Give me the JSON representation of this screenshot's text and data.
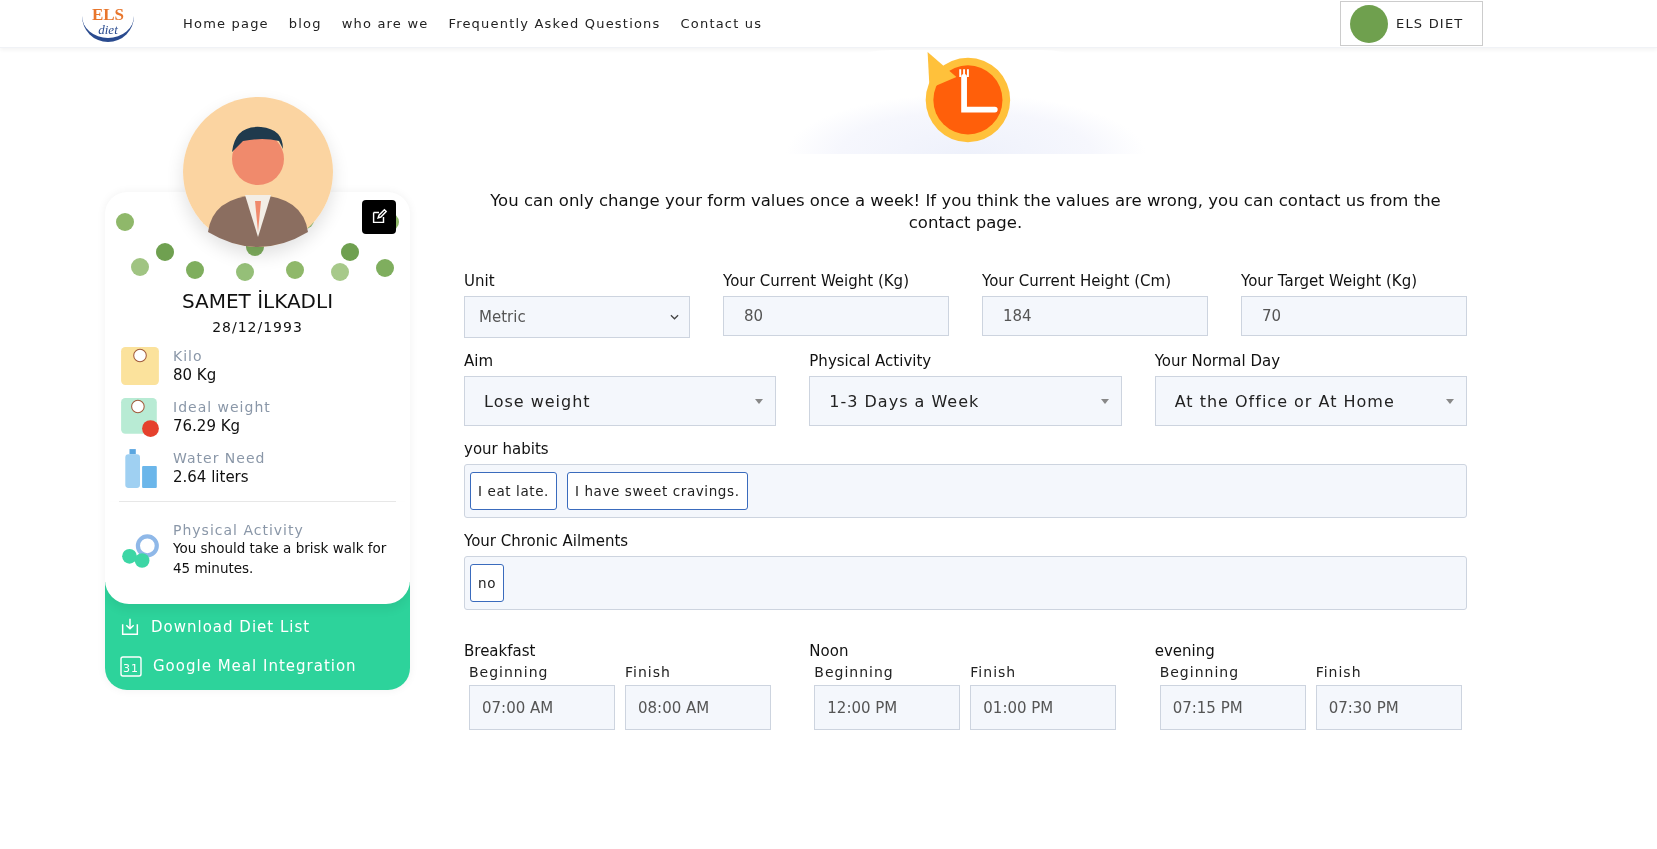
{
  "nav": {
    "logo": {
      "top": "ELS",
      "bottom": "diet"
    },
    "links": [
      {
        "label": "Home page"
      },
      {
        "label": "blog"
      },
      {
        "label": "who are we"
      },
      {
        "label": "Frequently Asked Questions"
      },
      {
        "label": "Contact us"
      }
    ],
    "user_button": {
      "label": "ELS DIET"
    }
  },
  "profile": {
    "name": "SAMET İLKADLI",
    "birth_date": "28/12/1993",
    "stats": [
      {
        "kind": "scale",
        "label": "Kilo",
        "value": "80 Kg"
      },
      {
        "kind": "ideal",
        "label": "Ideal weight",
        "value": "76.29 Kg"
      },
      {
        "kind": "water",
        "label": "Water Need",
        "value": "2.64 liters"
      }
    ],
    "activity": {
      "label": "Physical Activity",
      "text": "You should take a brisk walk for 45 minutes."
    },
    "actions": [
      {
        "kind": "download",
        "label": "Download Diet List"
      },
      {
        "kind": "calendar",
        "icon_text": "31",
        "label": "Google Meal Integration"
      }
    ]
  },
  "notice": "You can only change your form values once a week! If you think the values are wrong, you can contact us from the contact page.",
  "row_1": [
    {
      "kind": "select",
      "label": "Unit",
      "value": "Metric"
    },
    {
      "kind": "input",
      "label": "Your Current Weight (Kg)",
      "value": "80"
    },
    {
      "kind": "input",
      "label": "Your Current Height (Cm)",
      "value": "184"
    },
    {
      "kind": "input",
      "label": "Your Target Weight (Kg)",
      "value": "70"
    }
  ],
  "row_2": [
    {
      "kind": "dropdown",
      "label": "Aim",
      "value": "Lose weight"
    },
    {
      "kind": "dropdown",
      "label": "Physical Activity",
      "value": "1-3 Days a Week"
    },
    {
      "kind": "dropdown",
      "label": "Your Normal Day",
      "value": "At the Office or At Home"
    }
  ],
  "habits": {
    "label": "your habits",
    "tags": [
      "I eat late.",
      "I have sweet cravings."
    ]
  },
  "ailments": {
    "label": "Your Chronic Ailments",
    "tags": [
      "no"
    ]
  },
  "meals": [
    {
      "label": "Breakfast",
      "beginning_label": "Beginning",
      "beginning": "07:00 AM",
      "finish_label": "Finish",
      "finish": "08:00 AM"
    },
    {
      "label": "Noon",
      "beginning_label": "Beginning",
      "beginning": "12:00 PM",
      "finish_label": "Finish",
      "finish": "01:00 PM"
    },
    {
      "label": "evening",
      "beginning_label": "Beginning",
      "beginning": "07:15 PM",
      "finish_label": "Finish",
      "finish": "07:30 PM"
    }
  ]
}
